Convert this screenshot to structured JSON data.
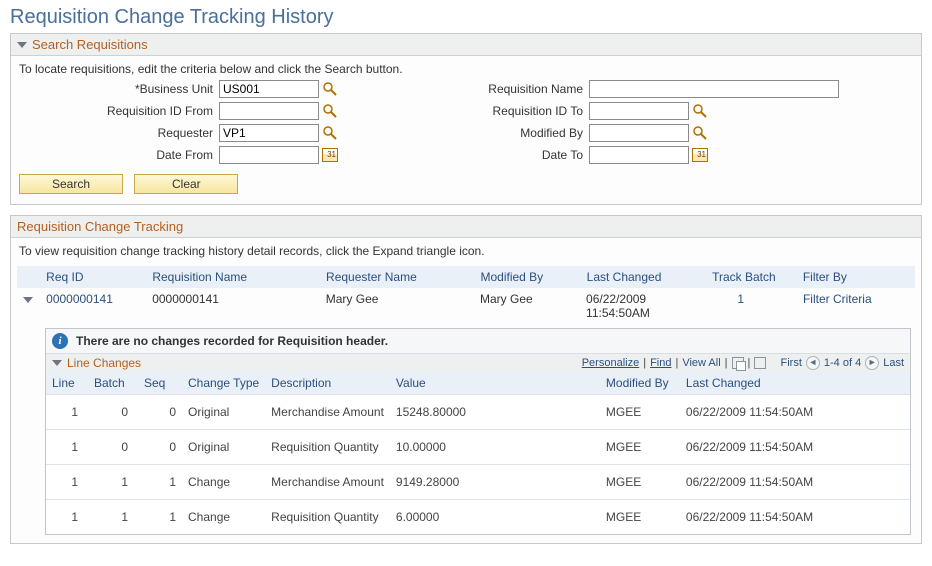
{
  "page": {
    "title": "Requisition Change Tracking History"
  },
  "search_panel": {
    "heading": "Search Requisitions",
    "instruction": "To locate requisitions, edit the criteria below and click the Search button.",
    "labels": {
      "business_unit": "*Business Unit",
      "req_id_from": "Requisition ID From",
      "requester": "Requester",
      "date_from": "Date From",
      "req_name": "Requisition Name",
      "req_id_to": "Requisition ID To",
      "modified_by": "Modified By",
      "date_to": "Date To"
    },
    "values": {
      "business_unit": "US001",
      "req_id_from": "",
      "requester": "VP1",
      "date_from": "",
      "req_name": "",
      "req_id_to": "",
      "modified_by": "",
      "date_to": ""
    },
    "buttons": {
      "search": "Search",
      "clear": "Clear"
    }
  },
  "tracking_panel": {
    "heading": "Requisition Change Tracking",
    "instruction": "To view requisition change tracking history detail records, click the Expand triangle icon.",
    "columns": {
      "req_id": "Req ID",
      "req_name": "Requisition Name",
      "requester_name": "Requester Name",
      "modified_by": "Modified By",
      "last_changed": "Last Changed",
      "track_batch": "Track Batch",
      "filter_by": "Filter By"
    },
    "row": {
      "req_id": "0000000141",
      "req_name": "0000000141",
      "requester_name": "Mary Gee",
      "modified_by": "Mary Gee",
      "last_changed_date": "06/22/2009",
      "last_changed_time": "11:54:50AM",
      "track_batch": "1",
      "filter_by": "Filter Criteria"
    },
    "info_bar": "There are no changes recorded for Requisition header.",
    "line_changes": {
      "heading": "Line Changes",
      "tools": {
        "personalize": "Personalize",
        "find": "Find",
        "view_all": "View All",
        "first": "First",
        "range": "1-4 of 4",
        "last": "Last"
      },
      "columns": {
        "line": "Line",
        "batch": "Batch",
        "seq": "Seq",
        "change_type": "Change Type",
        "description": "Description",
        "value": "Value",
        "modified_by": "Modified By",
        "last_changed": "Last Changed"
      },
      "rows": [
        {
          "line": "1",
          "batch": "0",
          "seq": "0",
          "change_type": "Original",
          "description": "Merchandise Amount",
          "value": "15248.80000",
          "modified_by": "MGEE",
          "last_changed": "06/22/2009 11:54:50AM"
        },
        {
          "line": "1",
          "batch": "0",
          "seq": "0",
          "change_type": "Original",
          "description": "Requisition Quantity",
          "value": "10.00000",
          "modified_by": "MGEE",
          "last_changed": "06/22/2009 11:54:50AM"
        },
        {
          "line": "1",
          "batch": "1",
          "seq": "1",
          "change_type": "Change",
          "description": "Merchandise Amount",
          "value": "9149.28000",
          "modified_by": "MGEE",
          "last_changed": "06/22/2009 11:54:50AM"
        },
        {
          "line": "1",
          "batch": "1",
          "seq": "1",
          "change_type": "Change",
          "description": "Requisition Quantity",
          "value": "6.00000",
          "modified_by": "MGEE",
          "last_changed": "06/22/2009 11:54:50AM"
        }
      ]
    }
  }
}
